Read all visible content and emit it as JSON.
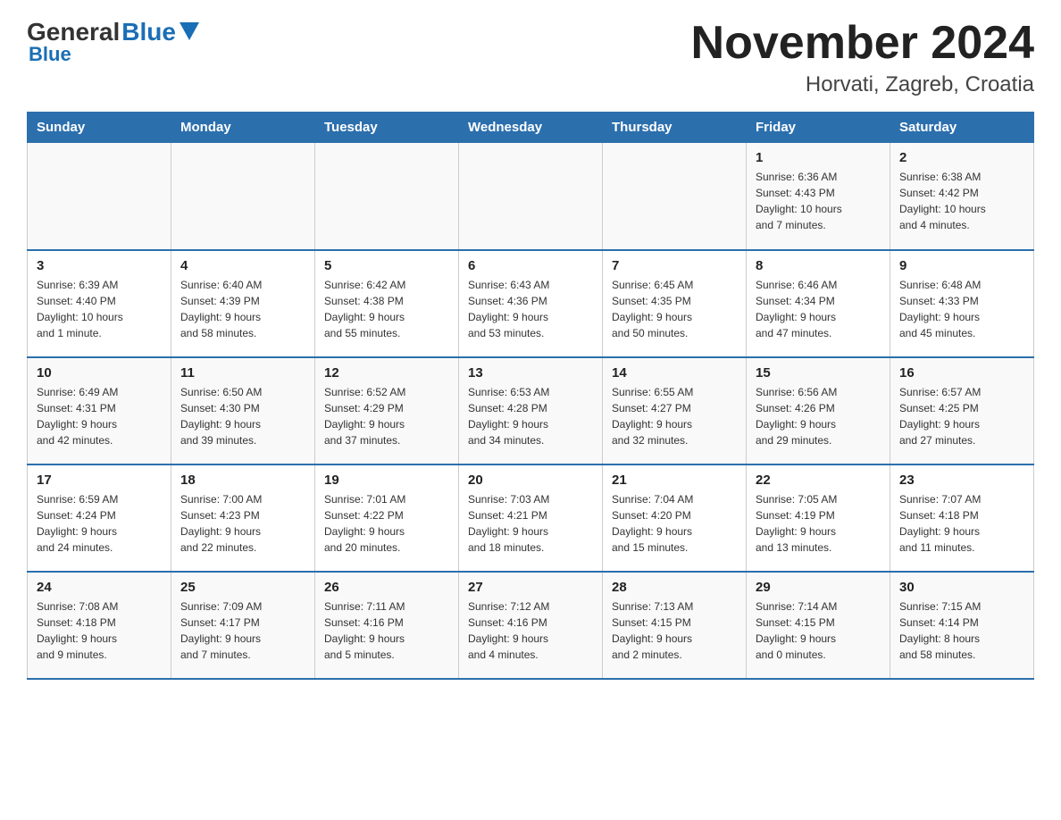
{
  "header": {
    "logo_general": "General",
    "logo_blue": "Blue",
    "month_title": "November 2024",
    "location": "Horvati, Zagreb, Croatia"
  },
  "days_of_week": [
    "Sunday",
    "Monday",
    "Tuesday",
    "Wednesday",
    "Thursday",
    "Friday",
    "Saturday"
  ],
  "weeks": [
    [
      {
        "day": "",
        "info": ""
      },
      {
        "day": "",
        "info": ""
      },
      {
        "day": "",
        "info": ""
      },
      {
        "day": "",
        "info": ""
      },
      {
        "day": "",
        "info": ""
      },
      {
        "day": "1",
        "info": "Sunrise: 6:36 AM\nSunset: 4:43 PM\nDaylight: 10 hours\nand 7 minutes."
      },
      {
        "day": "2",
        "info": "Sunrise: 6:38 AM\nSunset: 4:42 PM\nDaylight: 10 hours\nand 4 minutes."
      }
    ],
    [
      {
        "day": "3",
        "info": "Sunrise: 6:39 AM\nSunset: 4:40 PM\nDaylight: 10 hours\nand 1 minute."
      },
      {
        "day": "4",
        "info": "Sunrise: 6:40 AM\nSunset: 4:39 PM\nDaylight: 9 hours\nand 58 minutes."
      },
      {
        "day": "5",
        "info": "Sunrise: 6:42 AM\nSunset: 4:38 PM\nDaylight: 9 hours\nand 55 minutes."
      },
      {
        "day": "6",
        "info": "Sunrise: 6:43 AM\nSunset: 4:36 PM\nDaylight: 9 hours\nand 53 minutes."
      },
      {
        "day": "7",
        "info": "Sunrise: 6:45 AM\nSunset: 4:35 PM\nDaylight: 9 hours\nand 50 minutes."
      },
      {
        "day": "8",
        "info": "Sunrise: 6:46 AM\nSunset: 4:34 PM\nDaylight: 9 hours\nand 47 minutes."
      },
      {
        "day": "9",
        "info": "Sunrise: 6:48 AM\nSunset: 4:33 PM\nDaylight: 9 hours\nand 45 minutes."
      }
    ],
    [
      {
        "day": "10",
        "info": "Sunrise: 6:49 AM\nSunset: 4:31 PM\nDaylight: 9 hours\nand 42 minutes."
      },
      {
        "day": "11",
        "info": "Sunrise: 6:50 AM\nSunset: 4:30 PM\nDaylight: 9 hours\nand 39 minutes."
      },
      {
        "day": "12",
        "info": "Sunrise: 6:52 AM\nSunset: 4:29 PM\nDaylight: 9 hours\nand 37 minutes."
      },
      {
        "day": "13",
        "info": "Sunrise: 6:53 AM\nSunset: 4:28 PM\nDaylight: 9 hours\nand 34 minutes."
      },
      {
        "day": "14",
        "info": "Sunrise: 6:55 AM\nSunset: 4:27 PM\nDaylight: 9 hours\nand 32 minutes."
      },
      {
        "day": "15",
        "info": "Sunrise: 6:56 AM\nSunset: 4:26 PM\nDaylight: 9 hours\nand 29 minutes."
      },
      {
        "day": "16",
        "info": "Sunrise: 6:57 AM\nSunset: 4:25 PM\nDaylight: 9 hours\nand 27 minutes."
      }
    ],
    [
      {
        "day": "17",
        "info": "Sunrise: 6:59 AM\nSunset: 4:24 PM\nDaylight: 9 hours\nand 24 minutes."
      },
      {
        "day": "18",
        "info": "Sunrise: 7:00 AM\nSunset: 4:23 PM\nDaylight: 9 hours\nand 22 minutes."
      },
      {
        "day": "19",
        "info": "Sunrise: 7:01 AM\nSunset: 4:22 PM\nDaylight: 9 hours\nand 20 minutes."
      },
      {
        "day": "20",
        "info": "Sunrise: 7:03 AM\nSunset: 4:21 PM\nDaylight: 9 hours\nand 18 minutes."
      },
      {
        "day": "21",
        "info": "Sunrise: 7:04 AM\nSunset: 4:20 PM\nDaylight: 9 hours\nand 15 minutes."
      },
      {
        "day": "22",
        "info": "Sunrise: 7:05 AM\nSunset: 4:19 PM\nDaylight: 9 hours\nand 13 minutes."
      },
      {
        "day": "23",
        "info": "Sunrise: 7:07 AM\nSunset: 4:18 PM\nDaylight: 9 hours\nand 11 minutes."
      }
    ],
    [
      {
        "day": "24",
        "info": "Sunrise: 7:08 AM\nSunset: 4:18 PM\nDaylight: 9 hours\nand 9 minutes."
      },
      {
        "day": "25",
        "info": "Sunrise: 7:09 AM\nSunset: 4:17 PM\nDaylight: 9 hours\nand 7 minutes."
      },
      {
        "day": "26",
        "info": "Sunrise: 7:11 AM\nSunset: 4:16 PM\nDaylight: 9 hours\nand 5 minutes."
      },
      {
        "day": "27",
        "info": "Sunrise: 7:12 AM\nSunset: 4:16 PM\nDaylight: 9 hours\nand 4 minutes."
      },
      {
        "day": "28",
        "info": "Sunrise: 7:13 AM\nSunset: 4:15 PM\nDaylight: 9 hours\nand 2 minutes."
      },
      {
        "day": "29",
        "info": "Sunrise: 7:14 AM\nSunset: 4:15 PM\nDaylight: 9 hours\nand 0 minutes."
      },
      {
        "day": "30",
        "info": "Sunrise: 7:15 AM\nSunset: 4:14 PM\nDaylight: 8 hours\nand 58 minutes."
      }
    ]
  ]
}
